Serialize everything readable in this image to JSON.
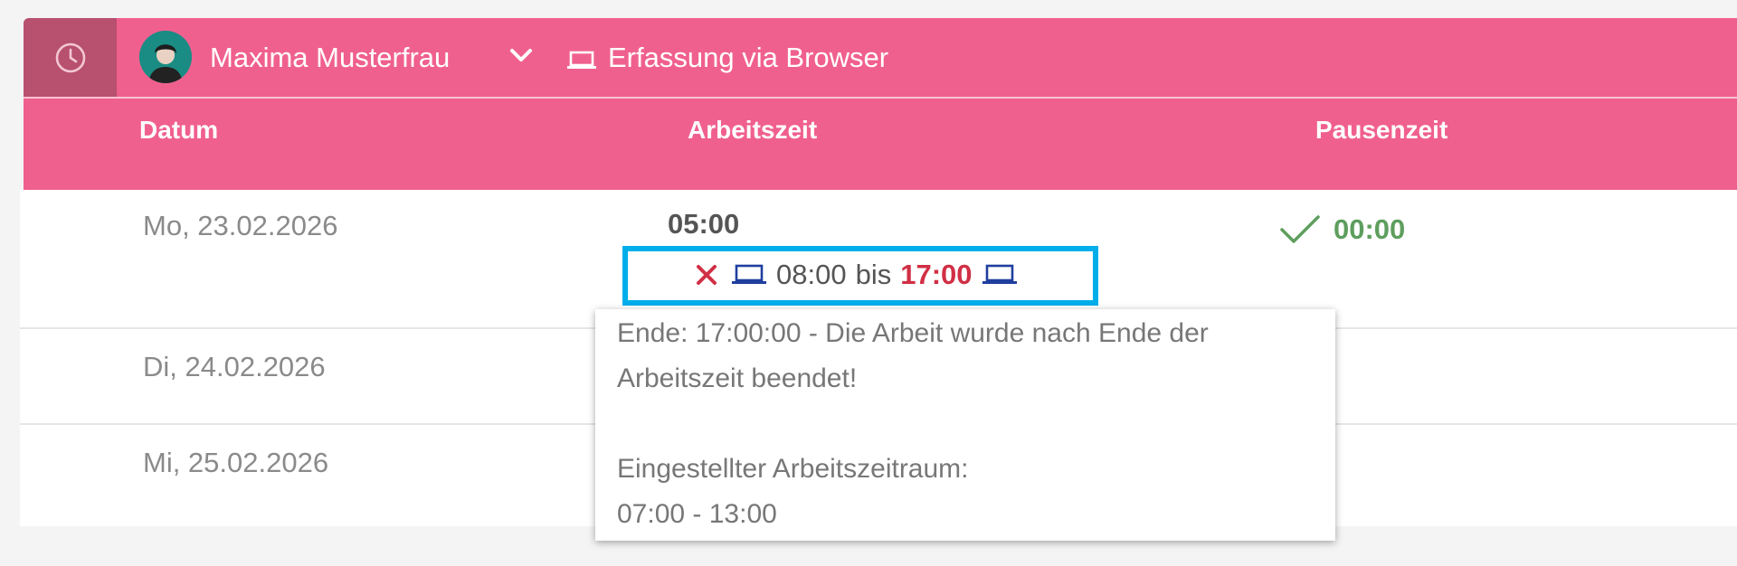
{
  "header": {
    "user_name": "Maxima Musterfrau",
    "mode_label": "Erfassung via Browser"
  },
  "table": {
    "columns": [
      "Datum",
      "Arbeitszeit",
      "Pausenzeit"
    ],
    "rows": [
      {
        "date": "Mo, 23.02.2026",
        "work_total": "05:00",
        "entry_start": "08:00",
        "entry_sep": "bis",
        "entry_end": "17:00",
        "pause": "00:00"
      },
      {
        "date": "Di, 24.02.2026"
      },
      {
        "date": "Mi, 25.02.2026"
      }
    ]
  },
  "tooltip": {
    "line1": "Ende: 17:00:00 - Die Arbeit wurde nach Ende der",
    "line2": "Arbeitszeit beendet!",
    "line3": "Eingestellter Arbeitszeitraum:",
    "line4": "07:00 - 13:00"
  },
  "colors": {
    "header": "#f0608f",
    "clock_button": "#b8506f",
    "error": "#d12f45",
    "ok": "#5e9e5e",
    "highlight": "#00aeea",
    "device_icon": "#1f3f9e"
  },
  "icons": [
    "clock-icon",
    "avatar",
    "chevron-down-icon",
    "laptop-icon",
    "error-x-icon",
    "check-icon"
  ]
}
